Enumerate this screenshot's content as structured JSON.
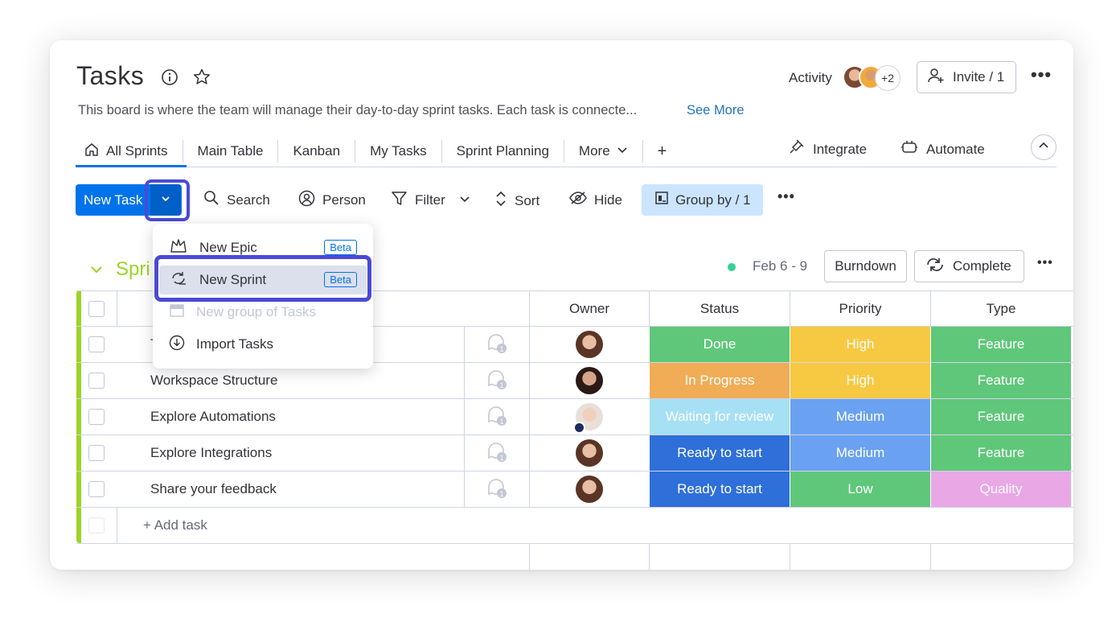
{
  "header": {
    "title": "Tasks",
    "description": "This board is where the team will manage their day-to-day sprint tasks. Each task is connecte...",
    "see_more": "See More",
    "activity_label": "Activity",
    "activity_extra_count": "+2",
    "invite_label": "Invite / 1"
  },
  "tabs": [
    {
      "label": "All Sprints",
      "icon": "home-icon",
      "active": true
    },
    {
      "label": "Main Table"
    },
    {
      "label": "Kanban"
    },
    {
      "label": "My Tasks"
    },
    {
      "label": "Sprint Planning"
    },
    {
      "label": "More",
      "icon": "chevron-down-icon"
    }
  ],
  "tab_add": "+",
  "right_tabs": {
    "integrate": "Integrate",
    "automate": "Automate"
  },
  "toolbar": {
    "new_task": "New Task",
    "search": "Search",
    "person": "Person",
    "filter": "Filter",
    "sort": "Sort",
    "hide": "Hide",
    "group_by": "Group by / 1"
  },
  "dropdown": {
    "items": [
      {
        "label": "New Epic",
        "badge": "Beta",
        "icon": "epic-icon"
      },
      {
        "label": "New Sprint",
        "badge": "Beta",
        "icon": "sprint-icon",
        "highlighted": true
      },
      {
        "label": "New group of Tasks",
        "icon": "group-icon",
        "disabled": true
      },
      {
        "label": "Import Tasks",
        "icon": "import-icon"
      }
    ]
  },
  "group": {
    "title": "Spri",
    "date_range": "Feb 6 - 9",
    "burndown": "Burndown",
    "complete": "Complete"
  },
  "columns": {
    "owner": "Owner",
    "status": "Status",
    "priority": "Priority",
    "type": "Type"
  },
  "rows": [
    {
      "task": "T",
      "updates": "1",
      "status": "Done",
      "priority": "High",
      "type": "Feature"
    },
    {
      "task": "Workspace Structure",
      "updates": "1",
      "status": "In Progress",
      "priority": "High",
      "type": "Feature"
    },
    {
      "task": "Explore Automations",
      "updates": "1",
      "status": "Waiting for review",
      "priority": "Medium",
      "type": "Feature"
    },
    {
      "task": "Explore Integrations",
      "updates": "1",
      "status": "Ready to start",
      "priority": "Medium",
      "type": "Feature"
    },
    {
      "task": "Share your feedback",
      "updates": "1",
      "status": "Ready to start",
      "priority": "Low",
      "type": "Quality"
    }
  ],
  "add_task": "+ Add task",
  "colors": {
    "accent": "#0073ea",
    "group_green": "#9cd326",
    "done": "#5fc77a",
    "in_progress": "#f1ac56",
    "waiting": "#a6e0f5",
    "ready": "#2e6fd9",
    "high": "#f7c842",
    "medium": "#6aa1f0",
    "low": "#5fc77a",
    "feature": "#5fc77a",
    "quality": "#e9a7e6",
    "highlight_border": "#4a4ad6"
  }
}
